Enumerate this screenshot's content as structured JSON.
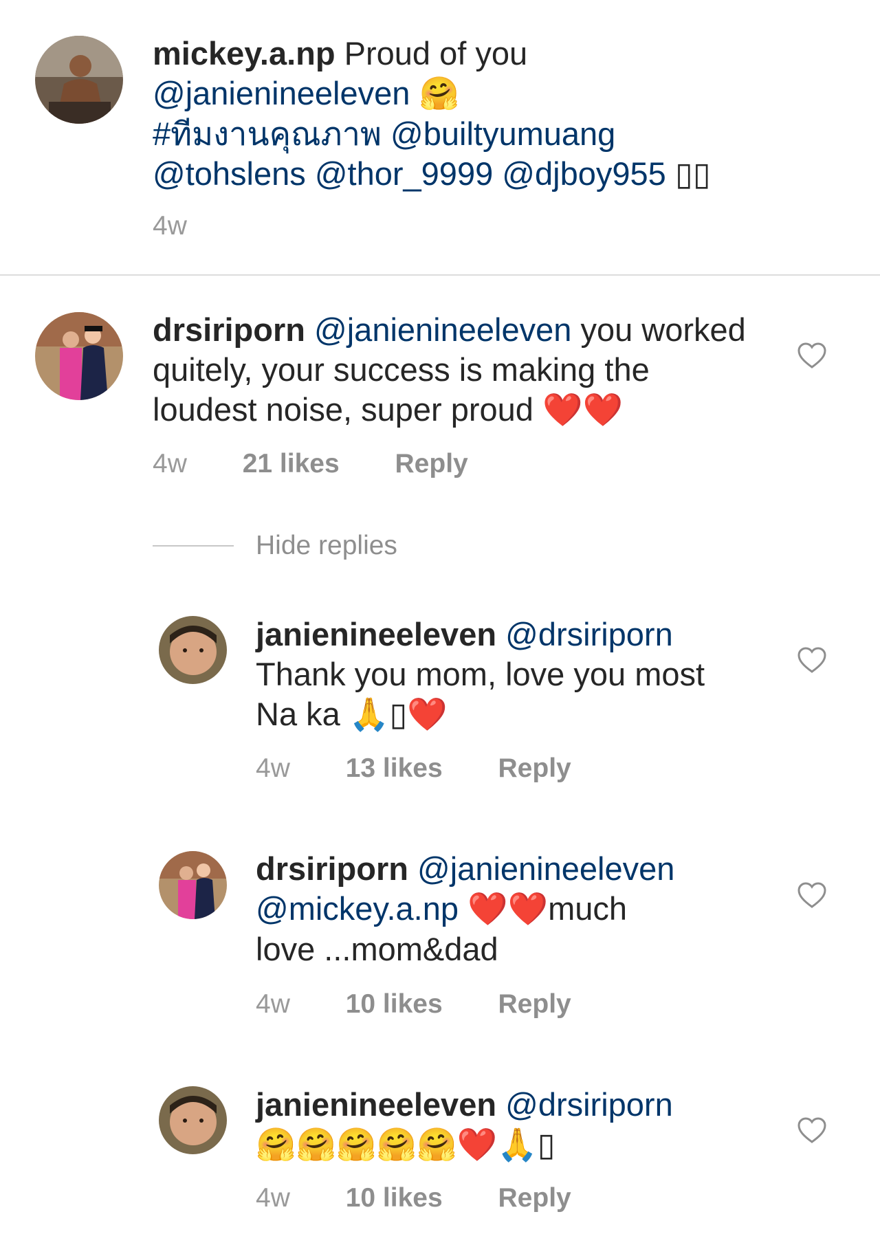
{
  "comments": [
    {
      "username": "mickey.a.np",
      "text_plain": "Proud of you",
      "line2_mention": "@janienineeleven",
      "line2_emoji": "🤗",
      "line3": "#ทีมงานคุณภาพ @builtyumuang",
      "line4": "@tohslens @thor_9999 @djboy955",
      "line4_glyph": "▯▯",
      "time": "4w"
    },
    {
      "username": "drsiriporn",
      "mention": "@janienineeleven",
      "text_l1": "you worked",
      "text_l2": "quitely, your success is making the",
      "text_l3": "loudest noise, super proud",
      "emoji": "❤️❤️",
      "time": "4w",
      "likes": "21 likes",
      "reply": "Reply"
    }
  ],
  "hide_replies": "Hide replies",
  "replies": [
    {
      "username": "janienineeleven",
      "mention": "@drsiriporn",
      "text_l2": "Thank you mom, love you most",
      "text_l3": "Na ka",
      "emoji_l3": "🙏",
      "glyph_l3": "▯",
      "emoji_l3b": "❤️",
      "time": "4w",
      "likes": "13 likes",
      "reply": "Reply"
    },
    {
      "username": "drsiriporn",
      "mention": "@janienineeleven",
      "mention2": "@mickey.a.np",
      "emoji_l2": "❤️❤️",
      "text_l2": "much",
      "text_l3": "love ...mom&dad",
      "time": "4w",
      "likes": "10 likes",
      "reply": "Reply"
    },
    {
      "username": "janienineeleven",
      "mention": "@drsiriporn",
      "emoji_l2": "🤗🤗🤗🤗🤗❤️🙏",
      "glyph_l2": "▯",
      "time": "4w",
      "likes": "10 likes",
      "reply": "Reply"
    }
  ],
  "icons": {
    "like": "heart-outline-icon",
    "avatar": "profile-photo"
  },
  "colors": {
    "mention": "#003569",
    "meta": "#999999",
    "divider": "#dcdcdc"
  }
}
